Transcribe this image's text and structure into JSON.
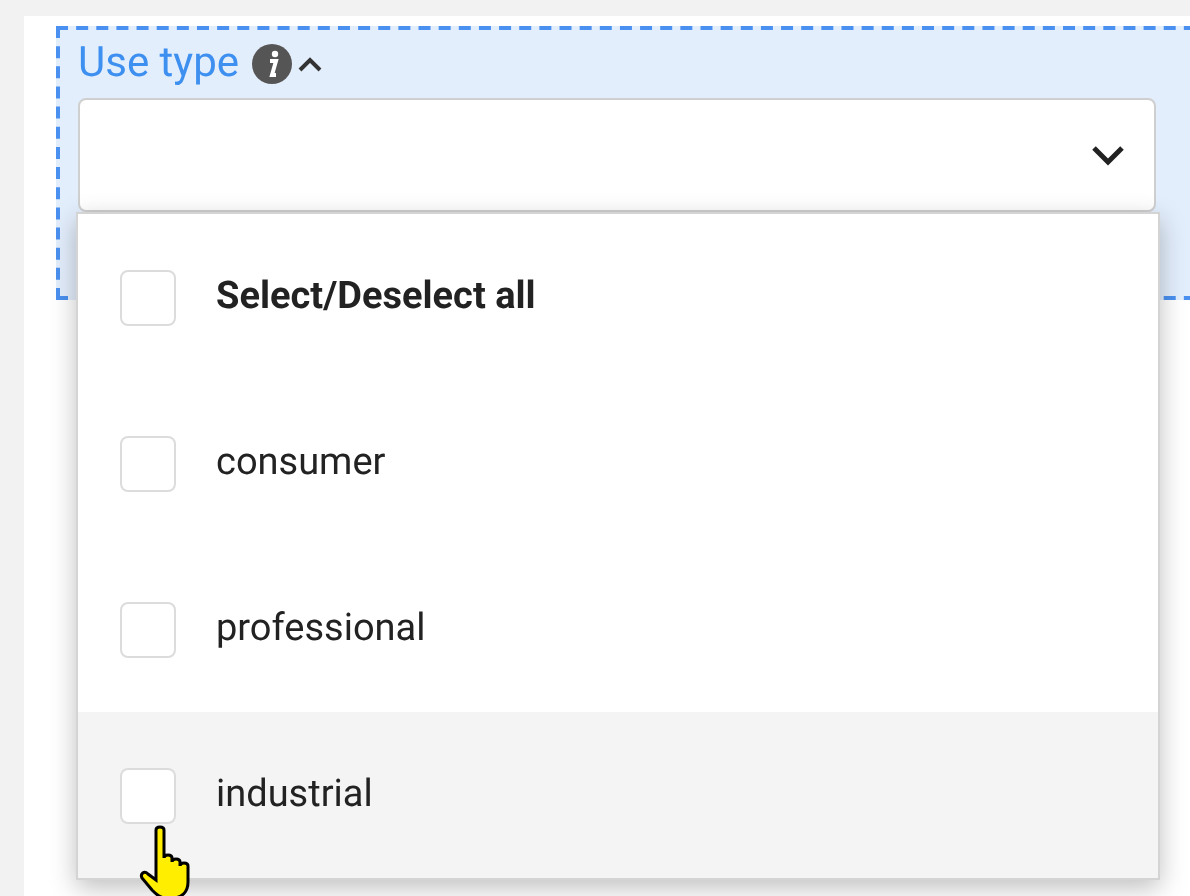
{
  "field": {
    "label": "Use type",
    "expanded": true
  },
  "options": [
    {
      "label": "Select/Deselect all",
      "kind": "all",
      "checked": false,
      "hovered": false
    },
    {
      "label": "consumer",
      "kind": "option",
      "checked": false,
      "hovered": false
    },
    {
      "label": "professional",
      "kind": "option",
      "checked": false,
      "hovered": false
    },
    {
      "label": "industrial",
      "kind": "option",
      "checked": false,
      "hovered": true
    }
  ]
}
